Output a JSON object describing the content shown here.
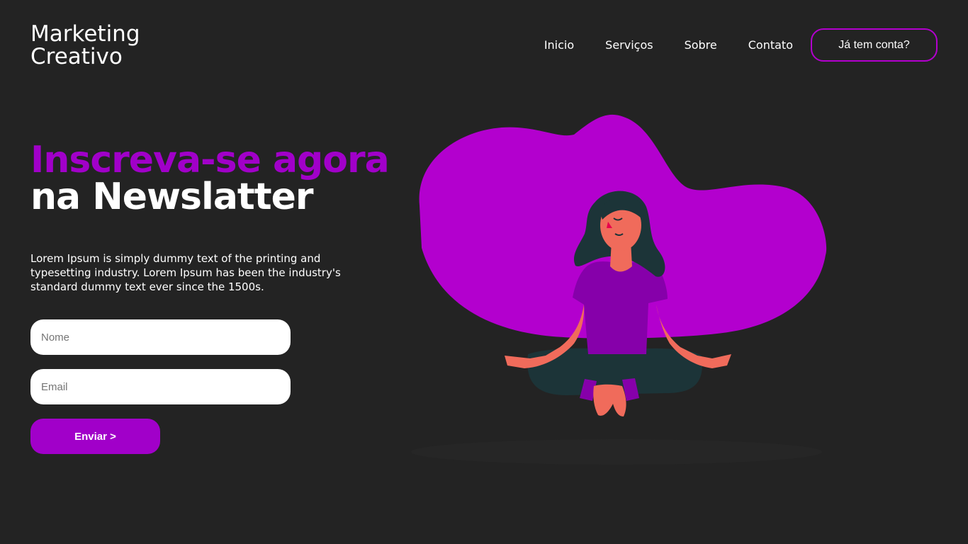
{
  "brand": {
    "line1": "Marketing",
    "line2": "Creativo"
  },
  "nav": {
    "items": [
      {
        "label": "Inicio"
      },
      {
        "label": "Serviços"
      },
      {
        "label": "Sobre"
      },
      {
        "label": "Contato"
      }
    ],
    "account_label": "Já tem conta?"
  },
  "hero": {
    "title_line1": "Inscreva-se agora",
    "title_line2": "na Newslatter",
    "description": "Lorem Ipsum is simply dummy text of the printing and typesetting industry. Lorem Ipsum has been the industry's standard dummy text ever since the 1500s."
  },
  "form": {
    "name_placeholder": "Nome",
    "email_placeholder": "Email",
    "submit_label": "Enviar >"
  },
  "colors": {
    "background": "#232323",
    "accent": "#a100c9",
    "blob": "#b300ce",
    "skin": "#f06b5b",
    "hair": "#1c3438"
  }
}
